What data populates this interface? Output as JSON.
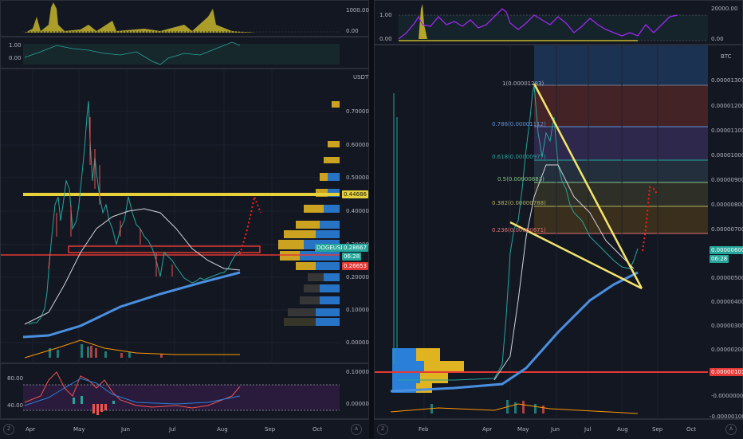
{
  "colors": {
    "background": "#131722",
    "grid": "#1e222d",
    "candle_up": "#26a69a",
    "candle_down": "#ef5350",
    "ema_blue": "#4a90e2",
    "sma_white": "#d1d4dc",
    "support_yellow": "#e6d13a",
    "resistance_red": "#e53935",
    "volume_profile_yellow": "#e0b320",
    "volume_profile_blue": "#2a7fd8",
    "price_green": "#26a69a",
    "prediction_red": "#ff1e1e",
    "purple_line": "#9c27f2"
  },
  "left_chart": {
    "volume_oscillator": {
      "ticks": [
        "1000.00",
        "0.00"
      ]
    },
    "correlation": {
      "ticks": [
        "1.00",
        "0.00"
      ]
    },
    "main": {
      "unit": "USDT",
      "ticks": [
        "0.70000",
        "0.60000",
        "0.50000",
        "0.40000",
        "0.30000",
        "0.20000",
        "0.10000",
        "0.00000"
      ],
      "support_level": "0.44686",
      "current_price": "0.28667",
      "symbol": "DOGEUSDT",
      "countdown": "06:28",
      "resistance_level": "0.26653"
    },
    "rsi": {
      "ticks": [
        "80.00",
        "40.00"
      ],
      "right_ticks": [
        "0.10000",
        "0.00000"
      ]
    },
    "x_axis": [
      "Apr",
      "May",
      "Jun",
      "Jul",
      "Aug",
      "Sep",
      "Oct"
    ],
    "tz_icon": "Z",
    "auto_icon": "A"
  },
  "right_chart": {
    "top_indicator": {
      "ticks_left": [
        "1.00",
        "0.00"
      ],
      "ticks_right": [
        "20000.00",
        "0.00"
      ]
    },
    "main": {
      "unit": "BTC",
      "ticks": [
        "0.00001300",
        "0.00001200",
        "0.00001100",
        "0.00001000",
        "0.00000900",
        "0.00000800",
        "0.00000700",
        "0.00000600",
        "0.00000500",
        "0.00000400",
        "0.00000300",
        "0.00000200",
        "0.00000101",
        "-0.00000000",
        "-0.00000100"
      ],
      "current_price": "0.00000600",
      "countdown": "06:28",
      "level_price": "0.00000101",
      "fib_labels": [
        "1(0.00001283)",
        "0.786(0.00001112)",
        "0.618(0.00000977)",
        "0.5(0.00000883)",
        "0.382(0.00000788)",
        "0.236(0.00000671)"
      ]
    },
    "x_axis": [
      "Feb",
      "Apr",
      "May",
      "Jun",
      "Jul",
      "Aug",
      "Sep",
      "Oct"
    ],
    "tz_icon": "Z",
    "auto_icon": "A"
  }
}
